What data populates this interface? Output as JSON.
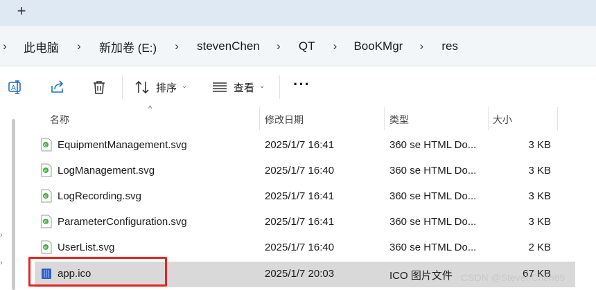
{
  "tabstrip": {
    "new_tab_label": "+"
  },
  "breadcrumb": {
    "items": [
      "此电脑",
      "新加卷 (E:)",
      "stevenChen",
      "QT",
      "BooKMgr",
      "res"
    ],
    "separator": "›"
  },
  "toolbar": {
    "sort_label": "排序",
    "view_label": "查看",
    "more_label": "···"
  },
  "columns": {
    "name": "名称",
    "modified": "修改日期",
    "type": "类型",
    "size": "大小"
  },
  "files": [
    {
      "name": "EquipmentManagement.svg",
      "modified": "2025/1/7 16:41",
      "type": "360 se HTML Do...",
      "size": "3 KB",
      "icon": "svg-file-icon",
      "selected": false
    },
    {
      "name": "LogManagement.svg",
      "modified": "2025/1/7 16:40",
      "type": "360 se HTML Do...",
      "size": "3 KB",
      "icon": "svg-file-icon",
      "selected": false
    },
    {
      "name": "LogRecording.svg",
      "modified": "2025/1/7 16:41",
      "type": "360 se HTML Do...",
      "size": "3 KB",
      "icon": "svg-file-icon",
      "selected": false
    },
    {
      "name": "ParameterConfiguration.svg",
      "modified": "2025/1/7 16:41",
      "type": "360 se HTML Do...",
      "size": "3 KB",
      "icon": "svg-file-icon",
      "selected": false
    },
    {
      "name": "UserList.svg",
      "modified": "2025/1/7 16:40",
      "type": "360 se HTML Do...",
      "size": "2 KB",
      "icon": "svg-file-icon",
      "selected": false
    },
    {
      "name": "app.ico",
      "modified": "2025/1/7 20:03",
      "type": "ICO 图片文件",
      "size": "67 KB",
      "icon": "ico-file-icon",
      "selected": true
    }
  ],
  "watermark": "CSDN @StevenChen85",
  "colors": {
    "highlight": "#e8231f",
    "selected_row": "#d9d9d9",
    "tabstrip": "#dfe9f3"
  }
}
